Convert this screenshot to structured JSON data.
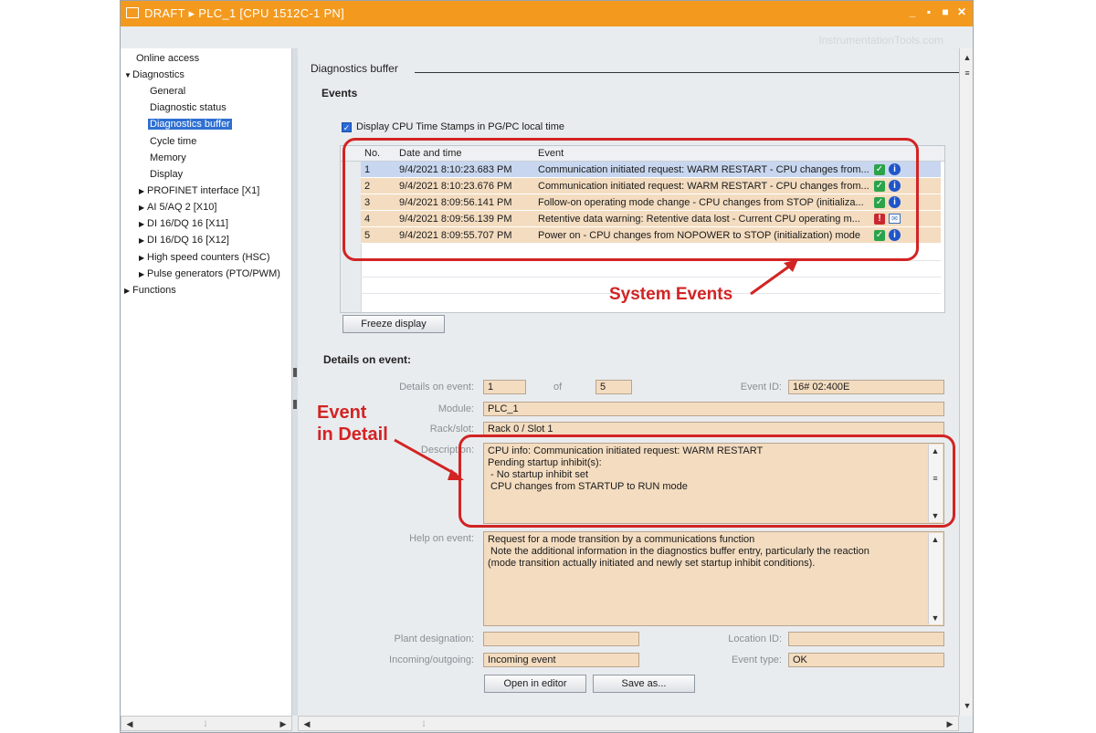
{
  "window": {
    "title": "DRAFT  ▸  PLC_1 [CPU 1512C-1 PN]",
    "controls": [
      "_",
      "▪",
      "■",
      "✕"
    ],
    "watermark": "InstrumentationTools.com"
  },
  "sidebar": {
    "items": [
      {
        "label": "Online access",
        "level": 0
      },
      {
        "label": "Diagnostics",
        "level": 0,
        "expanded": true
      },
      {
        "label": "General",
        "level": 1
      },
      {
        "label": "Diagnostic status",
        "level": 1
      },
      {
        "label": "Diagnostics buffer",
        "level": 1,
        "selected": true
      },
      {
        "label": "Cycle time",
        "level": 1
      },
      {
        "label": "Memory",
        "level": 1
      },
      {
        "label": "Display",
        "level": 1
      },
      {
        "label": "PROFINET interface [X1]",
        "level": 1,
        "collapsed": true
      },
      {
        "label": "AI 5/AQ 2 [X10]",
        "level": 1,
        "collapsed": true
      },
      {
        "label": "DI 16/DQ 16 [X11]",
        "level": 1,
        "collapsed": true
      },
      {
        "label": "DI 16/DQ 16 [X12]",
        "level": 1,
        "collapsed": true
      },
      {
        "label": "High speed counters (HSC)",
        "level": 1,
        "collapsed": true
      },
      {
        "label": "Pulse generators (PTO/PWM)",
        "level": 1,
        "collapsed": true
      },
      {
        "label": "Functions",
        "level": 0,
        "collapsed": true
      }
    ]
  },
  "main": {
    "section_title": "Diagnostics buffer",
    "events_title": "Events",
    "display_timestamps_label": "Display CPU Time Stamps in PG/PC local time",
    "columns": {
      "no": "No.",
      "date": "Date and time",
      "event": "Event"
    },
    "events": [
      {
        "no": "1",
        "date": "9/4/2021 8:10:23.683 PM",
        "event": "Communication initiated request: WARM RESTART - CPU changes from...",
        "icon1": "check-icon",
        "icon2": "info-icon",
        "selected": true
      },
      {
        "no": "2",
        "date": "9/4/2021 8:10:23.676 PM",
        "event": "Communication initiated request: WARM RESTART - CPU changes from...",
        "icon1": "check-icon",
        "icon2": "info-icon"
      },
      {
        "no": "3",
        "date": "9/4/2021 8:09:56.141 PM",
        "event": "Follow-on operating mode change  - CPU changes from STOP (initializa...",
        "icon1": "check-icon",
        "icon2": "info-icon"
      },
      {
        "no": "4",
        "date": "9/4/2021 8:09:56.139 PM",
        "event": "Retentive data warning: Retentive data lost - Current CPU operating m...",
        "icon1": "warning-icon",
        "icon2": "message-icon"
      },
      {
        "no": "5",
        "date": "9/4/2021 8:09:55.707 PM",
        "event": "Power on  - CPU changes from NOPOWER to STOP (initialization) mode",
        "icon1": "check-icon",
        "icon2": "info-icon"
      }
    ],
    "freeze_button": "Freeze display",
    "details_title": "Details on event:",
    "details": {
      "details_on_event_label": "Details on event:",
      "event_index": "1",
      "of_label": "of",
      "event_total": "5",
      "event_id_label": "Event ID:",
      "event_id": "16# 02:400E",
      "module_label": "Module:",
      "module": "PLC_1",
      "rack_label": "Rack/slot:",
      "rack": "Rack 0 / Slot 1",
      "description_label": "Description:",
      "description_lines": [
        "CPU info: Communication initiated request: WARM RESTART",
        "Pending startup inhibit(s):",
        " - No startup inhibit set",
        "",
        " CPU changes from STARTUP to RUN mode"
      ],
      "help_label": "Help on event:",
      "help_lines": [
        "Request for a mode transition by a communications function",
        " Note the additional information in the diagnostics buffer entry, particularly the reaction",
        "(mode transition actually initiated and newly set startup inhibit conditions)."
      ],
      "plant_label": "Plant designation:",
      "plant": "",
      "location_label": "Location ID:",
      "location": "",
      "incoming_label": "Incoming/outgoing:",
      "incoming": "Incoming event",
      "event_type_label": "Event type:",
      "event_type": "OK"
    },
    "open_editor_button": "Open in editor",
    "save_as_button": "Save as..."
  },
  "annotations": {
    "system_events": "System Events",
    "event_line1": "Event",
    "event_line2": "in Detail",
    "color": "#d22424"
  }
}
